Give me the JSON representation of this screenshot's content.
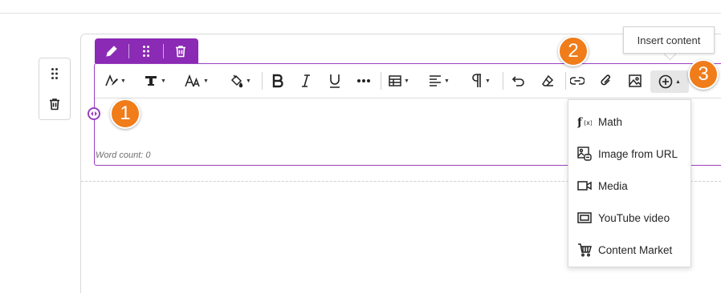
{
  "block_toolbar": {
    "edit_icon": "pencil-icon",
    "drag_icon": "drag-dots-icon",
    "delete_icon": "trash-icon"
  },
  "side_panel": {
    "drag_icon": "drag-dots-icon",
    "delete_icon": "trash-icon"
  },
  "editor": {
    "word_count": "Word count: 0",
    "toolbar": [
      {
        "name": "text-style",
        "icon": "text-style-icon",
        "dropdown": true
      },
      {
        "name": "font",
        "icon": "font-family-icon",
        "dropdown": true
      },
      {
        "name": "font-size",
        "icon": "font-size-icon",
        "dropdown": true
      },
      {
        "name": "highlight",
        "icon": "paint-bucket-icon",
        "dropdown": true
      },
      {
        "name": "bold",
        "icon": "bold-icon",
        "dropdown": false
      },
      {
        "name": "italic",
        "icon": "italic-icon",
        "dropdown": false
      },
      {
        "name": "underline",
        "icon": "underline-icon",
        "dropdown": false
      },
      {
        "name": "more",
        "icon": "more-icon",
        "dropdown": false
      },
      {
        "name": "table",
        "icon": "table-icon",
        "dropdown": true
      },
      {
        "name": "align",
        "icon": "align-left-icon",
        "dropdown": true
      },
      {
        "name": "paragraph",
        "icon": "paragraph-icon",
        "dropdown": true
      },
      {
        "name": "undo",
        "icon": "undo-icon",
        "dropdown": false
      },
      {
        "name": "clear-format",
        "icon": "eraser-icon",
        "dropdown": false
      },
      {
        "name": "link",
        "icon": "link-icon",
        "dropdown": false
      },
      {
        "name": "attach",
        "icon": "paperclip-icon",
        "dropdown": false
      },
      {
        "name": "image",
        "icon": "image-icon",
        "dropdown": false
      },
      {
        "name": "insert-content",
        "icon": "plus-circle-icon",
        "dropdown": true
      }
    ]
  },
  "tooltip": {
    "text": "Insert content"
  },
  "callouts": [
    "1",
    "2",
    "3"
  ],
  "insert_menu": {
    "items": [
      {
        "label": "Math",
        "icon": "math-function-icon"
      },
      {
        "label": "Image from URL",
        "icon": "image-link-icon"
      },
      {
        "label": "Media",
        "icon": "video-icon"
      },
      {
        "label": "YouTube video",
        "icon": "youtube-icon"
      },
      {
        "label": "Content Market",
        "icon": "cart-icon"
      }
    ]
  },
  "colors": {
    "accent": "#8b2ab4",
    "callout": "#f07c1a"
  }
}
